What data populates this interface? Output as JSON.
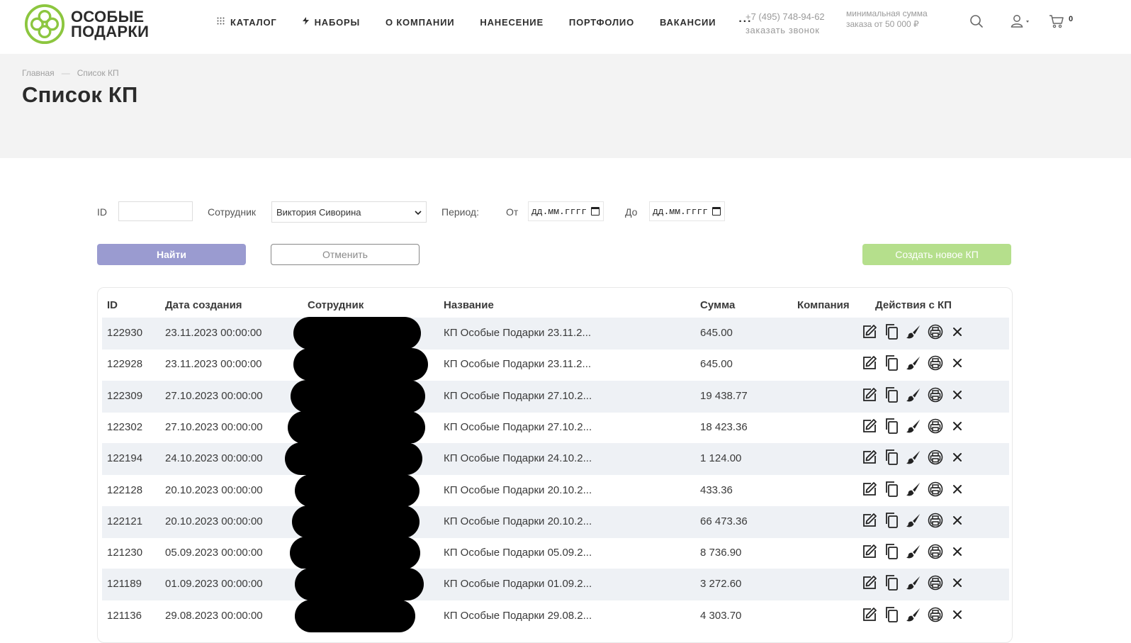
{
  "brand": {
    "line1": "ОСОБЫЕ",
    "line2": "ПОДАРКИ",
    "accent": "#8cc63f"
  },
  "nav": {
    "items": [
      {
        "label": "КАТАЛОГ",
        "icon": "grid-icon"
      },
      {
        "label": "НАБОРЫ",
        "icon": "lightning-icon"
      },
      {
        "label": "О КОМПАНИИ"
      },
      {
        "label": "НАНЕСЕНИЕ"
      },
      {
        "label": "ПОРТФОЛИО"
      },
      {
        "label": "ВАКАНСИИ"
      }
    ],
    "more": "···"
  },
  "contact": {
    "phone": "+7 (495) 748-94-62",
    "callback": "заказать звонок"
  },
  "min_order": {
    "line1": "минимальная сумма",
    "line2": "заказа от 50 000 ₽"
  },
  "cart": {
    "count": "0"
  },
  "breadcrumb": {
    "home": "Главная",
    "sep": "—",
    "current": "Список КП"
  },
  "page": {
    "title": "Список КП"
  },
  "filters": {
    "id_label": "ID",
    "id_value": "",
    "employee_label": "Сотрудник",
    "employee_value": "Виктория Сиворина",
    "period_label": "Период:",
    "from_label": "От",
    "from_value": "дд.мм.гггг",
    "to_label": "До",
    "to_value": "дд.мм.гггг"
  },
  "buttons": {
    "find": "Найти",
    "cancel": "Отменить",
    "create": "Создать новое КП"
  },
  "colors": {
    "find_bg": "#9a9bd0",
    "create_bg": "#b5df8c",
    "row_alt": "#eef1f5"
  },
  "table": {
    "headers": [
      "ID",
      "Дата создания",
      "Сотрудник",
      "Название",
      "Сумма",
      "Компания",
      "Действия с КП"
    ],
    "rows": [
      {
        "id": "122930",
        "date": "23.11.2023 00:00:00",
        "name": "КП Особые Подарки 23.11.2...",
        "sum": "645.00",
        "company": ""
      },
      {
        "id": "122928",
        "date": "23.11.2023 00:00:00",
        "name": "КП Особые Подарки 23.11.2...",
        "sum": "645.00",
        "company": ""
      },
      {
        "id": "122309",
        "date": "27.10.2023 00:00:00",
        "name": "КП Особые Подарки 27.10.2...",
        "sum": "19 438.77",
        "company": ""
      },
      {
        "id": "122302",
        "date": "27.10.2023 00:00:00",
        "name": "КП Особые Подарки 27.10.2...",
        "sum": "18 423.36",
        "company": ""
      },
      {
        "id": "122194",
        "date": "24.10.2023 00:00:00",
        "name": "КП Особые Подарки 24.10.2...",
        "sum": "1 124.00",
        "company": ""
      },
      {
        "id": "122128",
        "date": "20.10.2023 00:00:00",
        "name": "КП Особые Подарки 20.10.2...",
        "sum": "433.36",
        "company": ""
      },
      {
        "id": "122121",
        "date": "20.10.2023 00:00:00",
        "name": "КП Особые Подарки 20.10.2...",
        "sum": "66 473.36",
        "company": ""
      },
      {
        "id": "121230",
        "date": "05.09.2023 00:00:00",
        "name": "КП Особые Подарки 05.09.2...",
        "sum": "8 736.90",
        "company": ""
      },
      {
        "id": "121189",
        "date": "01.09.2023 00:00:00",
        "name": "КП Особые Подарки 01.09.2...",
        "sum": "3 272.60",
        "company": ""
      },
      {
        "id": "121136",
        "date": "29.08.2023 00:00:00",
        "name": "КП Особые Подарки 29.08.2...",
        "sum": "4 303.70",
        "company": ""
      }
    ],
    "action_icons": [
      "edit-icon",
      "copy-icon",
      "brush-icon",
      "print-icon",
      "delete-icon"
    ]
  }
}
